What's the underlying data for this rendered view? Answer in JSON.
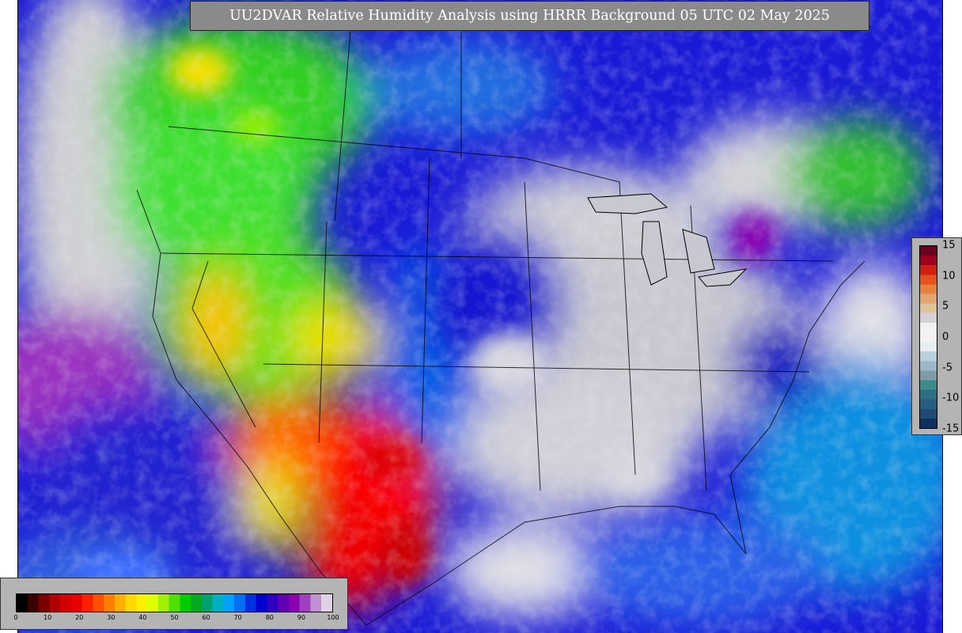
{
  "title": "UU2DVAR Relative Humidity Analysis using HRRR Background 05 UTC 02 May 2025",
  "map": {
    "field": "relative humidity",
    "region": "North America (HRRR domain)",
    "moist_color": "#c8c8c8",
    "dry_color": "#e00000"
  },
  "rh_colorbar": {
    "min": 0,
    "max": 100,
    "tick_labels": [
      "0",
      "10",
      "20",
      "30",
      "40",
      "50",
      "60",
      "70",
      "80",
      "90",
      "100"
    ],
    "colors": [
      "#000000",
      "#3a0000",
      "#7a0000",
      "#b00000",
      "#d40000",
      "#e80000",
      "#ff2000",
      "#ff5000",
      "#ff8000",
      "#ffb000",
      "#ffd800",
      "#fff000",
      "#e0ff00",
      "#a0f000",
      "#50e000",
      "#00cc00",
      "#00aa20",
      "#00a070",
      "#00b0c0",
      "#00a0ff",
      "#0070f0",
      "#0030e0",
      "#0000d0",
      "#3000c0",
      "#6000b0",
      "#8a00b0",
      "#a040c0",
      "#c090d0",
      "#e0d0e8"
    ]
  },
  "diff_colorbar": {
    "tick_labels": [
      "15",
      "10",
      "5",
      "0",
      "-5",
      "-10",
      "-15"
    ],
    "colors": [
      "#6b0020",
      "#a00020",
      "#d02010",
      "#e85020",
      "#e88040",
      "#e0a870",
      "#ddc49a",
      "#d8d0d8",
      "#f2f2f2",
      "#f2f2f2",
      "#e8eef0",
      "#b8d0dc",
      "#9ab8c8",
      "#809aa8",
      "#3c8c8c",
      "#2a7080",
      "#285c80",
      "#1e4a74",
      "#103060"
    ]
  }
}
